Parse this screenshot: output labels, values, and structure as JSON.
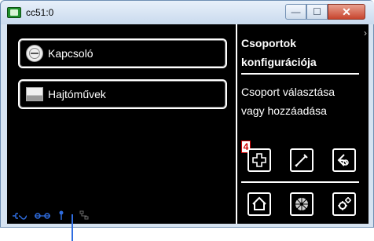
{
  "window": {
    "title": "cc51:0",
    "min_glyph": "—",
    "max_glyph": "☐",
    "close_glyph": "✕"
  },
  "left": {
    "buttons": [
      {
        "label": "Kapcsoló",
        "icon": "socket-icon"
      },
      {
        "label": "Hajtóművek",
        "icon": "blind-icon"
      }
    ]
  },
  "right": {
    "title_line1": "Csoportok",
    "title_line2": "konfigurációja",
    "subtitle_line1": "Csoport választása",
    "subtitle_line2": "vagy hozzáadása",
    "badge": "4",
    "chevron": "›"
  },
  "colors": {
    "background": "#000000",
    "text": "#ffffff",
    "status_blue": "#2f6de0",
    "badge_red": "#d10000"
  }
}
